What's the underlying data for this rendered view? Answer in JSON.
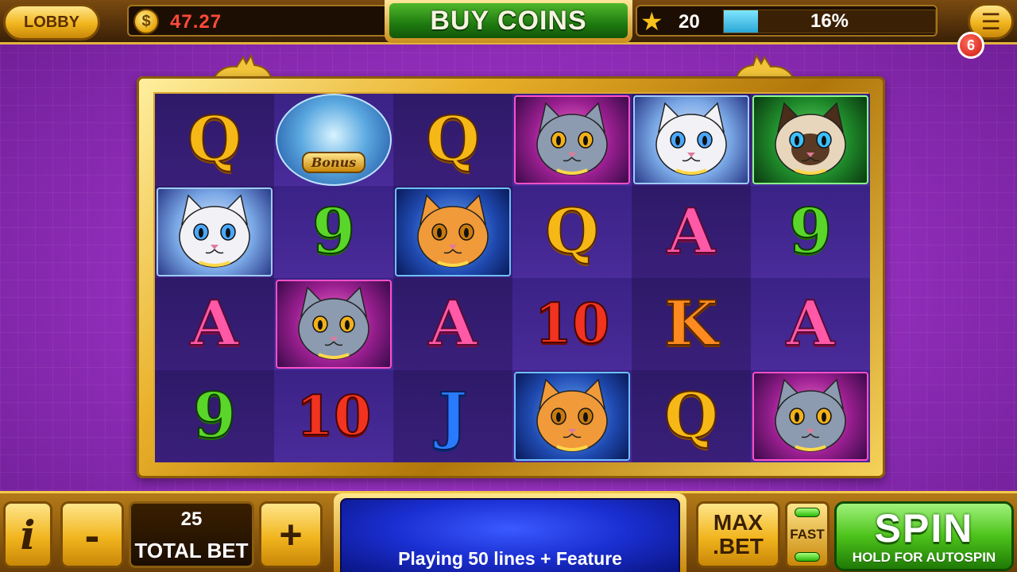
{
  "topbar": {
    "lobby_label": "LOBBY",
    "coin_glyph": "$",
    "balance": "47.27",
    "buy_coins_label": "BUY COINS",
    "level": "20",
    "xp_progress": 0.16,
    "xp_percent": "16%",
    "menu_icon": "menu-icon",
    "notification_count": "6"
  },
  "reels": {
    "rows": [
      [
        "Q",
        "bonus",
        "Q",
        "cat-grey",
        "cat-white",
        "cat-siamese"
      ],
      [
        "cat-white",
        "9",
        "cat-ginger",
        "Q",
        "A",
        "9"
      ],
      [
        "A",
        "cat-grey",
        "A",
        "10",
        "K",
        "A"
      ],
      [
        "9",
        "10",
        "J",
        "cat-ginger",
        "Q",
        "cat-grey"
      ]
    ],
    "bonus_label": "Bonus"
  },
  "bottombar": {
    "info_label": "i",
    "minus_label": "-",
    "plus_label": "+",
    "total_bet_value": "25",
    "total_bet_label": "TOTAL BET",
    "message": "Playing 50 lines + Feature",
    "max_bet_line1": "MAX",
    "max_bet_line2": ".BET",
    "fast_label": "FAST",
    "spin_label": "SPIN",
    "spin_sub_label": "HOLD FOR AUTOSPIN"
  },
  "colors": {
    "background": "#8a2bb0",
    "gold": "#f1b51e",
    "spin_green": "#4cc21a",
    "balance_red": "#ff4a3a"
  }
}
